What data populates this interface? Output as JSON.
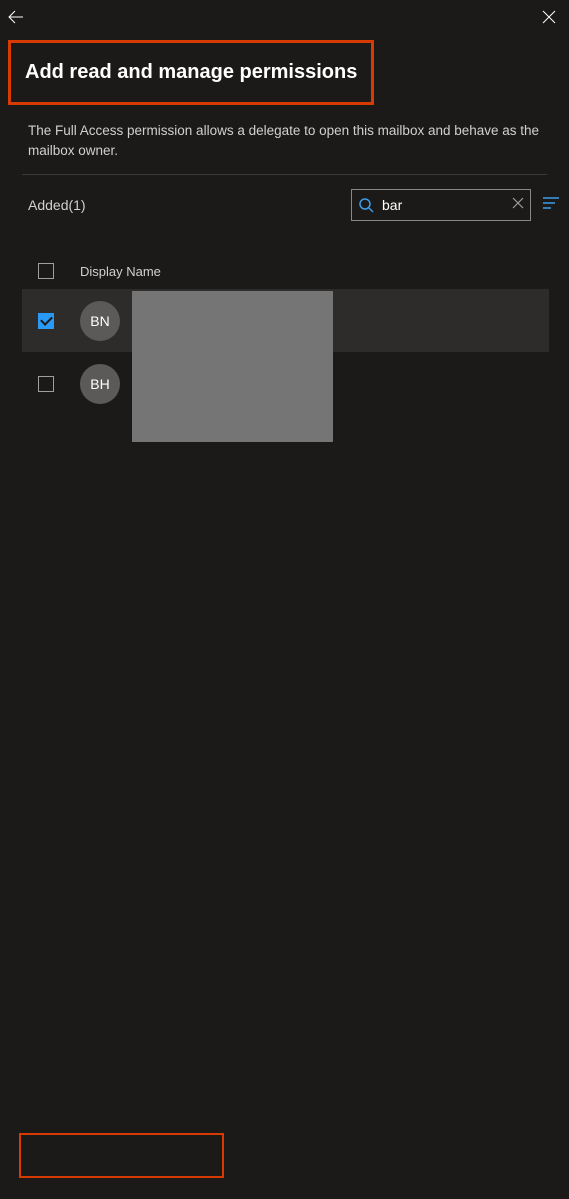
{
  "header": {
    "title": "Add read and manage permissions"
  },
  "description": "The Full Access permission allows a delegate to open this mailbox and behave as the mailbox owner.",
  "added_label": "Added(1)",
  "search": {
    "value": "bar"
  },
  "table": {
    "column_header": "Display Name",
    "rows": [
      {
        "initials": "BN",
        "selected": true
      },
      {
        "initials": "BH",
        "selected": false
      }
    ]
  }
}
